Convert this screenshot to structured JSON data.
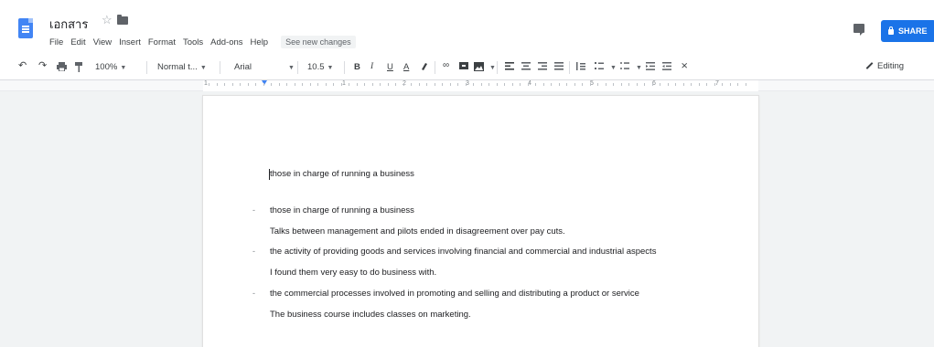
{
  "header": {
    "doc_title": "เอกสาร",
    "menu": [
      "File",
      "Edit",
      "View",
      "Insert",
      "Format",
      "Tools",
      "Add-ons",
      "Help"
    ],
    "see_new_changes": "See new changes",
    "share_label": "SHARE"
  },
  "toolbar": {
    "zoom": "100%",
    "style": "Normal t...",
    "font": "Arial",
    "font_size": "10.5",
    "bold": "B",
    "italic": "I",
    "underline": "U",
    "text_color": "A",
    "editing_label": "Editing"
  },
  "ruler": {
    "numbers": [
      "1",
      "1",
      "2",
      "3",
      "4",
      "5",
      "6",
      "7"
    ]
  },
  "document": {
    "lines": [
      {
        "text": "those in charge of running a business",
        "bullet": false
      },
      {
        "text": "those in charge of running a business",
        "bullet": true
      },
      {
        "text": "Talks between management and pilots ended in disagreement over pay cuts.",
        "bullet": false
      },
      {
        "text": "the activity of providing goods and services involving financial and commercial and industrial aspects",
        "bullet": true
      },
      {
        "text": "I found them very easy to do business with.",
        "bullet": false
      },
      {
        "text": "the commercial processes involved in promoting and selling and distributing a product or service",
        "bullet": true
      },
      {
        "text": "The business course includes classes on marketing.",
        "bullet": false
      }
    ],
    "bullet_glyph": "-"
  },
  "colors": {
    "accent": "#1a73e8",
    "doc_icon": "#4285f4"
  }
}
